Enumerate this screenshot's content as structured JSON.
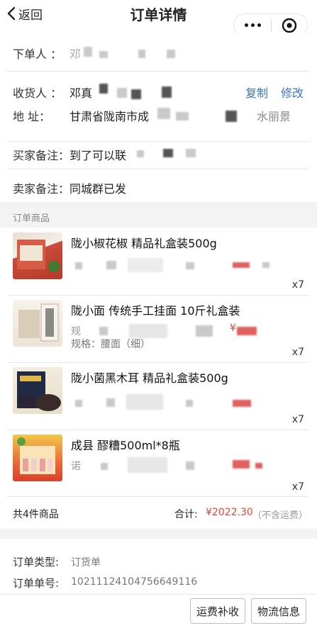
{
  "header": {
    "back_label": "返回",
    "title": "订单详情"
  },
  "orderer": {
    "label": "下单人 ：",
    "value": "邓"
  },
  "receiver": {
    "label": "收货人 ：",
    "value": "邓真",
    "copy_label": "复制",
    "edit_label": "修改"
  },
  "address": {
    "label": "地    址：",
    "value": "甘肃省陇南市成",
    "tail": "水丽景"
  },
  "buyer_note": {
    "label": "买家备注：",
    "value": "到了可以联"
  },
  "seller_note": {
    "label": "卖家备注：",
    "value": "同城群已发"
  },
  "goods_section": {
    "title": "订单商品"
  },
  "goods": [
    {
      "name": "陇小椒花椒 精品礼盒装500g",
      "qty": "x7",
      "spec": ""
    },
    {
      "name": "陇小面 传统手工挂面 10斤礼盒装",
      "qty": "x7",
      "spec": "规格：腰面（细）",
      "sub_prefix": "规",
      "price_prefix": "¥"
    },
    {
      "name": "陇小菌黑木耳 精品礼盒装500g",
      "qty": "x7",
      "spec": ""
    },
    {
      "name": "成县 醪糟500ml*8瓶",
      "qty": "x7",
      "spec": "",
      "sub_prefix": "诺"
    }
  ],
  "summary": {
    "count_label": "共4件商品",
    "total_label": "合计:",
    "total_value": "¥2022.30",
    "shipping_note": "（不含运费）"
  },
  "order_meta": {
    "type_label": "订单类型:",
    "type_value": "订货单",
    "number_label": "订单单号:",
    "number_value": "10211124104756649116"
  },
  "actions": {
    "freight_button": "运费补收",
    "logistics_button": "物流信息"
  },
  "colors": {
    "accent_link": "#3a74c8",
    "price_red": "#e2443a"
  }
}
